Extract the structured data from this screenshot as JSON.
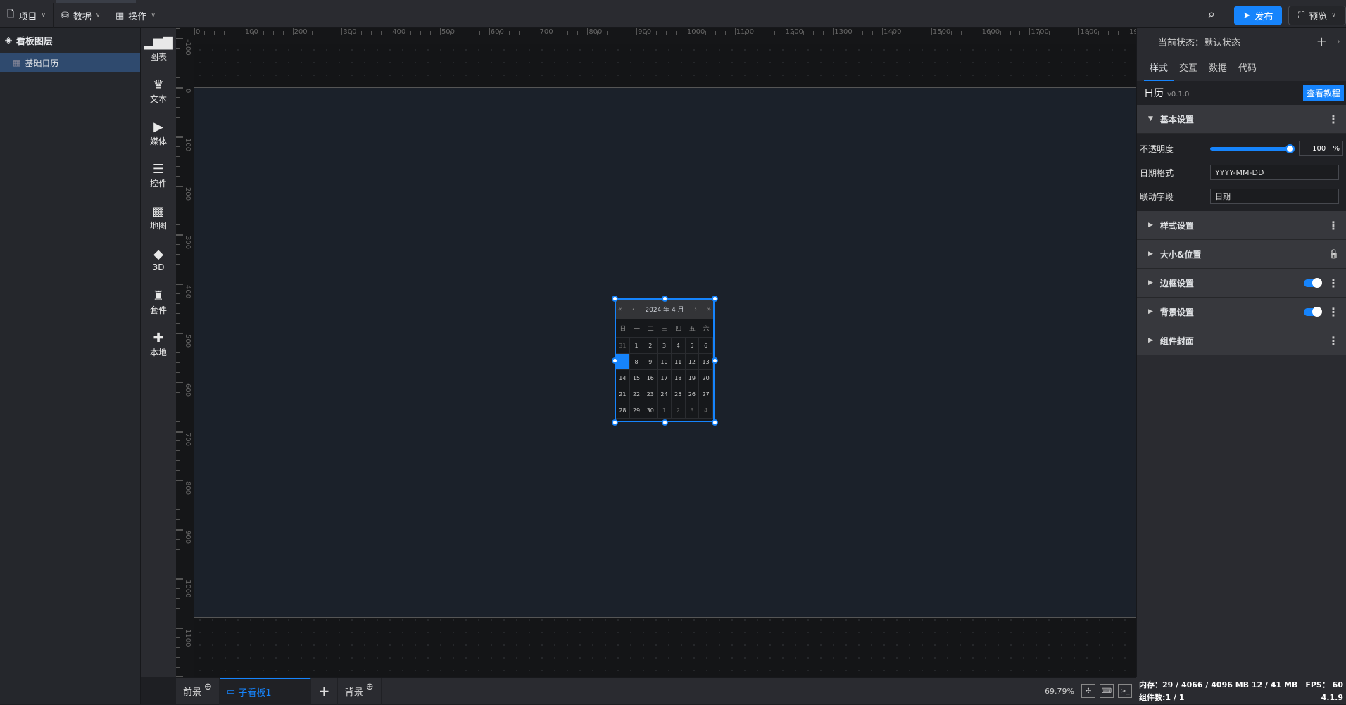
{
  "topbar": {
    "menus": [
      {
        "label": "项目",
        "icon": "file-icon"
      },
      {
        "label": "数据",
        "icon": "database-icon"
      },
      {
        "label": "操作",
        "icon": "grid-icon"
      }
    ],
    "publish": "发布",
    "preview": "预览"
  },
  "layers": {
    "title": "看板图层",
    "items": [
      {
        "label": "基础日历",
        "icon": "calendar-icon"
      }
    ]
  },
  "tools": [
    {
      "label": "图表",
      "icon": "bar-chart-icon",
      "glyph": "▂▆▇"
    },
    {
      "label": "文本",
      "icon": "crown-icon",
      "glyph": "♛"
    },
    {
      "label": "媒体",
      "icon": "camera-icon",
      "glyph": "▶"
    },
    {
      "label": "控件",
      "icon": "list-icon",
      "glyph": "☰"
    },
    {
      "label": "地图",
      "icon": "map-icon",
      "glyph": "▩"
    },
    {
      "label": "3D",
      "icon": "cube-icon",
      "glyph": "◆"
    },
    {
      "label": "套件",
      "icon": "shirt-icon",
      "glyph": "♜"
    },
    {
      "label": "本地",
      "icon": "puzzle-icon",
      "glyph": "✚"
    }
  ],
  "ruler": {
    "h": [
      -100,
      0,
      100,
      200,
      300,
      400,
      500,
      600,
      700,
      800,
      900,
      1000,
      1100,
      1200,
      1300,
      1400,
      1500,
      1600,
      1700,
      1800,
      1900
    ],
    "v": [
      -100,
      0,
      100,
      200,
      300,
      400,
      500,
      600,
      700,
      800,
      900,
      1000,
      1100,
      1200
    ]
  },
  "calendar": {
    "title": "2024 年 4 月",
    "prev_year": "«",
    "prev": "‹",
    "next": "›",
    "next_year": "»",
    "weekdays": [
      "日",
      "一",
      "二",
      "三",
      "四",
      "五",
      "六"
    ],
    "weeks": [
      [
        {
          "d": "31",
          "o": true
        },
        {
          "d": "1"
        },
        {
          "d": "2"
        },
        {
          "d": "3"
        },
        {
          "d": "4"
        },
        {
          "d": "5"
        },
        {
          "d": "6"
        }
      ],
      [
        {
          "d": "",
          "sel": true
        },
        {
          "d": "8"
        },
        {
          "d": "9"
        },
        {
          "d": "10"
        },
        {
          "d": "11"
        },
        {
          "d": "12"
        },
        {
          "d": "13"
        }
      ],
      [
        {
          "d": "14"
        },
        {
          "d": "15"
        },
        {
          "d": "16"
        },
        {
          "d": "17"
        },
        {
          "d": "18"
        },
        {
          "d": "19"
        },
        {
          "d": "20"
        }
      ],
      [
        {
          "d": "21"
        },
        {
          "d": "22"
        },
        {
          "d": "23"
        },
        {
          "d": "24"
        },
        {
          "d": "25"
        },
        {
          "d": "26"
        },
        {
          "d": "27"
        }
      ],
      [
        {
          "d": "28"
        },
        {
          "d": "29"
        },
        {
          "d": "30"
        },
        {
          "d": "1",
          "o": true
        },
        {
          "d": "2",
          "o": true
        },
        {
          "d": "3",
          "o": true
        },
        {
          "d": "4",
          "o": true
        }
      ]
    ]
  },
  "right": {
    "state": "当前状态：默认状态",
    "tabs": [
      "样式",
      "交互",
      "数据",
      "代码"
    ],
    "active_tab": 0,
    "component": "日历",
    "version": "v0.1.0",
    "tutorial": "查看教程",
    "basic": {
      "title": "基本设置",
      "opacity_label": "不透明度",
      "opacity": "100",
      "opacity_unit": "%",
      "format_label": "日期格式",
      "format": "YYYY-MM-DD",
      "field_label": "联动字段",
      "field": "日期"
    },
    "sections": [
      {
        "title": "样式设置",
        "extra": "dots"
      },
      {
        "title": "大小&位置",
        "extra": "lock"
      },
      {
        "title": "边框设置",
        "extra": "toggle",
        "on": true
      },
      {
        "title": "背景设置",
        "extra": "toggle",
        "on": true
      },
      {
        "title": "组件封面",
        "extra": "dots"
      }
    ]
  },
  "bottom": {
    "foreground": "前景",
    "board": "子看板1",
    "background": "背景",
    "zoom": "69.79%"
  },
  "status": {
    "memory": "内存：29 / 4066 / 4096 MB  12 / 41 MB",
    "fps": "FPS： 60",
    "components": "组件数:1 / 1",
    "version": "4.1.9"
  },
  "colors": {
    "accent": "#1684fc",
    "board": "#1b212a",
    "selected_layer": "#2f4a6e"
  }
}
